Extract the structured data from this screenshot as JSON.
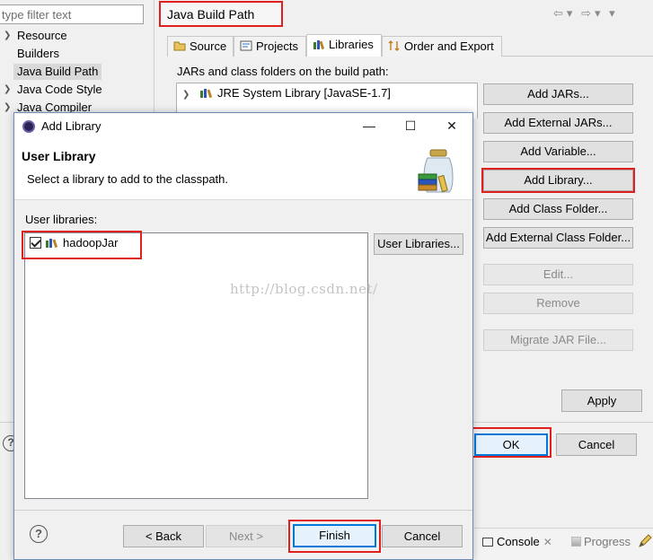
{
  "properties": {
    "filter_placeholder": "type filter text",
    "nav_items": [
      {
        "label": "Resource",
        "expandable": true
      },
      {
        "label": "Builders",
        "expandable": false
      },
      {
        "label": "Java Build Path",
        "expandable": false,
        "selected": true
      },
      {
        "label": "Java Code Style",
        "expandable": true
      },
      {
        "label": "Java Compiler",
        "expandable": true
      }
    ],
    "page_title": "Java Build Path",
    "history_glyphs": [
      "⇦",
      "▾",
      "⇨",
      "▾",
      "▾"
    ],
    "tabs": [
      {
        "label": "Source"
      },
      {
        "label": "Projects"
      },
      {
        "label": "Libraries",
        "active": true
      },
      {
        "label": "Order and Export"
      }
    ],
    "jars_label": "JARs and class folders on the build path:",
    "jar_tree": [
      {
        "label": "JRE System Library [JavaSE-1.7]"
      }
    ],
    "side_buttons": [
      {
        "label": "Add JARs...",
        "enabled": true
      },
      {
        "label": "Add External JARs...",
        "enabled": true
      },
      {
        "label": "Add Variable...",
        "enabled": true
      },
      {
        "label": "Add Library...",
        "enabled": true,
        "highlighted": true
      },
      {
        "label": "Add Class Folder...",
        "enabled": true
      },
      {
        "label": "Add External Class Folder...",
        "enabled": true
      },
      {
        "label": "Edit...",
        "enabled": false
      },
      {
        "label": "Remove",
        "enabled": false
      },
      {
        "label": "Migrate JAR File...",
        "enabled": false
      }
    ],
    "apply_label": "Apply",
    "ok_label": "OK",
    "cancel_label": "Cancel",
    "help_glyph": "?"
  },
  "bottom_views": {
    "console_label": "Console",
    "console_close": "✕",
    "progress_label": "Progress"
  },
  "dialog": {
    "title": "Add Library",
    "window_controls": {
      "minimize": "—",
      "maximize": "☐",
      "close": "✕"
    },
    "header_title": "User Library",
    "header_subtitle": "Select a library to add to the classpath.",
    "user_libraries_label": "User libraries:",
    "libraries": [
      {
        "name": "hadoopJar",
        "checked": true
      }
    ],
    "user_libraries_button": "User Libraries...",
    "watermark": "http://blog.csdn.net/",
    "help_glyph": "?",
    "buttons": {
      "back": "< Back",
      "next": "Next >",
      "finish": "Finish",
      "cancel": "Cancel"
    }
  },
  "colors": {
    "highlight_red": "#e0201f",
    "focus_blue": "#0078d7",
    "dialog_bg": "#f0f0f0"
  }
}
